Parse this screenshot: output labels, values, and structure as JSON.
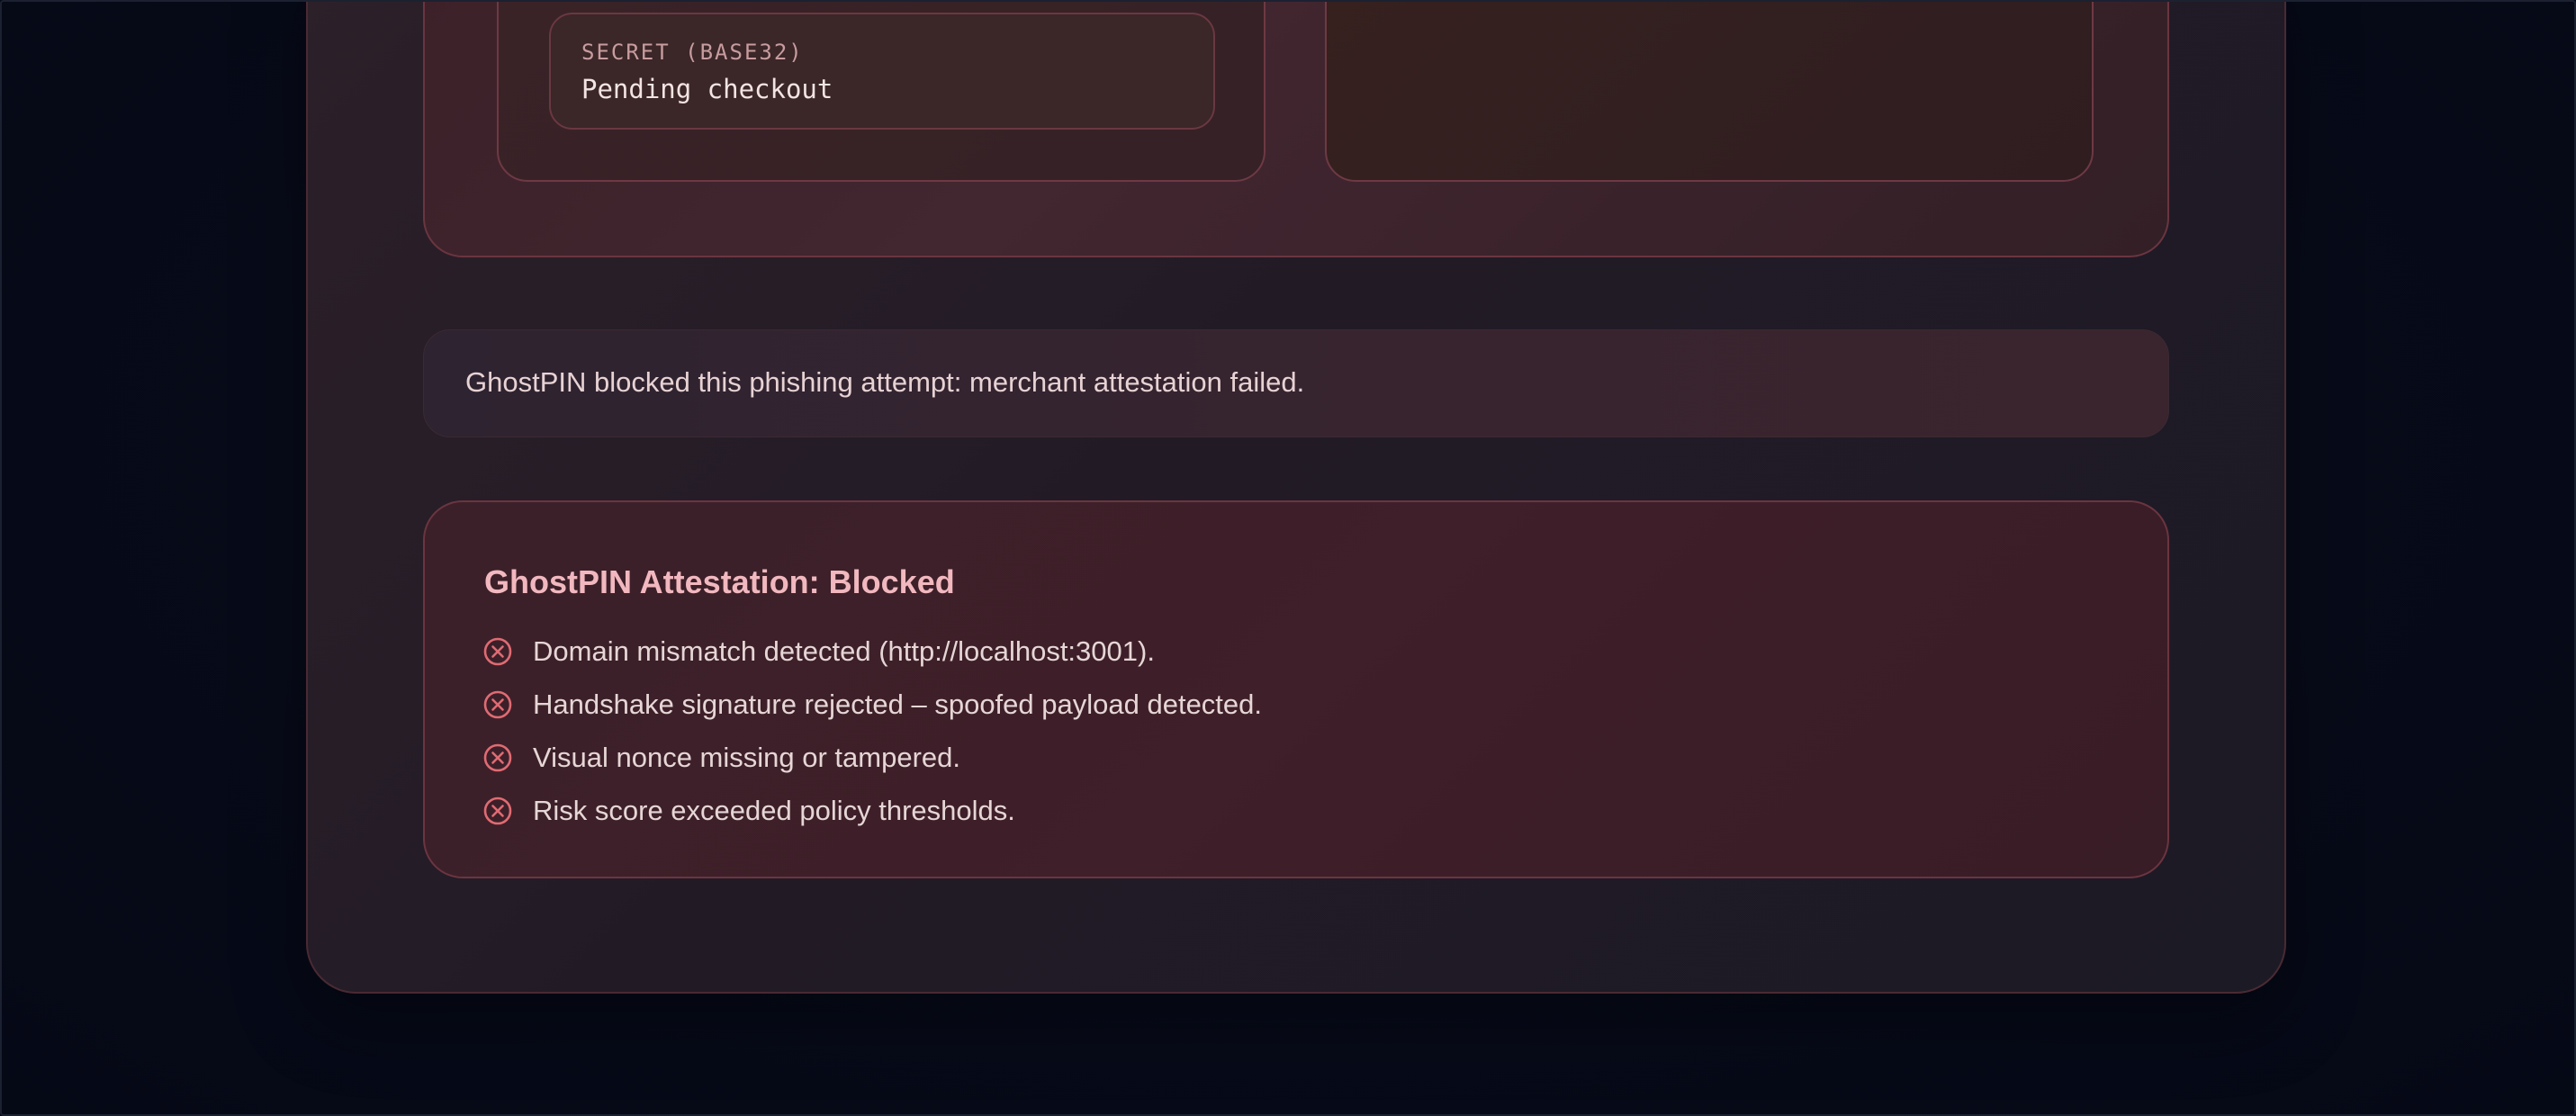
{
  "secret_field": {
    "label": "SECRET (BASE32)",
    "value": "Pending checkout"
  },
  "notice": {
    "text": "GhostPIN blocked this phishing attempt: merchant attestation failed."
  },
  "attestation": {
    "title": "GhostPIN Attestation: Blocked",
    "items": [
      {
        "text": "Domain mismatch detected (http://localhost:3001).",
        "icon": "x-circle-icon"
      },
      {
        "text": "Handshake signature rejected – spoofed payload detected.",
        "icon": "x-circle-icon"
      },
      {
        "text": "Visual nonce missing or tampered.",
        "icon": "x-circle-icon"
      },
      {
        "text": "Risk score exceeded policy thresholds.",
        "icon": "x-circle-icon"
      }
    ]
  },
  "colors": {
    "background": "#060a17",
    "danger_accent": "#e06b73",
    "title": "#f2b8bf"
  }
}
